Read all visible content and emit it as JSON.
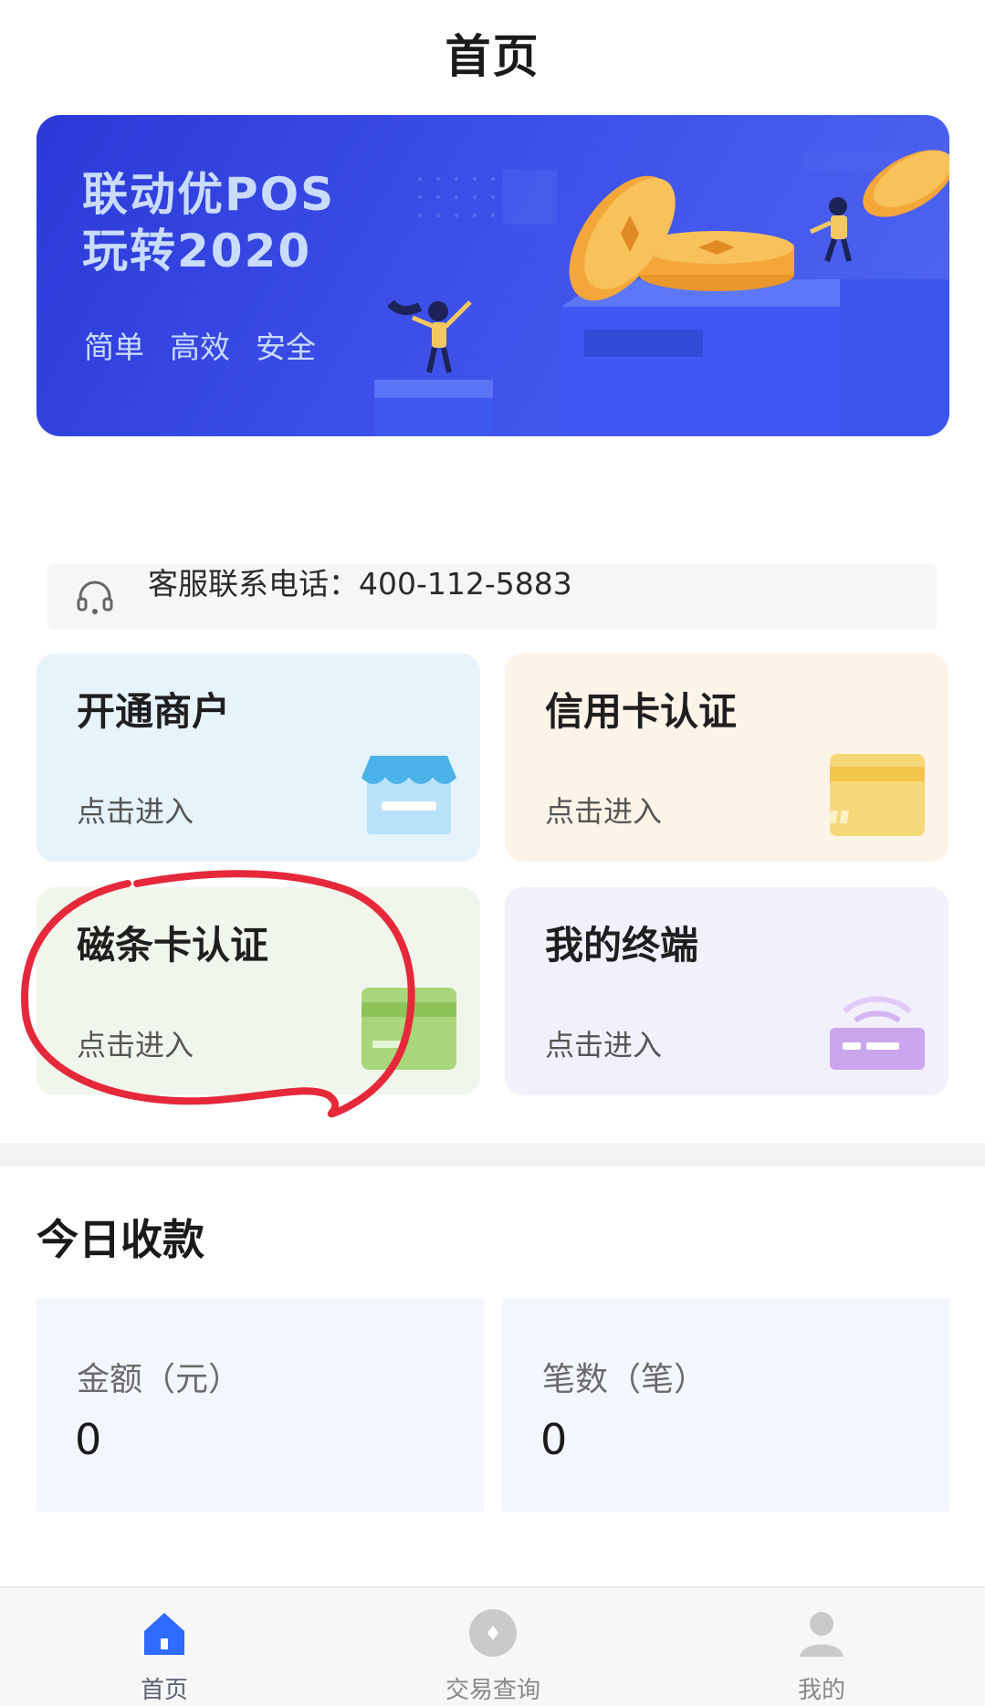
{
  "header": {
    "title": "首页"
  },
  "banner": {
    "title_line1": "联动优POS",
    "title_line2": "玩转2020",
    "tags": [
      "简单",
      "高效",
      "安全"
    ]
  },
  "service": {
    "text": "客服联系电话：400-112-5883",
    "icon": "headset-icon"
  },
  "cards": [
    {
      "title": "开通商户",
      "sub": "点击进入",
      "icon": "store-icon",
      "color": "#e6f3fb"
    },
    {
      "title": "信用卡认证",
      "sub": "点击进入",
      "icon": "credit-card-icon",
      "color": "#fdf4e8"
    },
    {
      "title": "磁条卡认证",
      "sub": "点击进入",
      "icon": "magstripe-card-icon",
      "color": "#f1f6ec"
    },
    {
      "title": "我的终端",
      "sub": "点击进入",
      "icon": "terminal-icon",
      "color": "#f2f0fa"
    }
  ],
  "today": {
    "title": "今日收款",
    "amount_label": "金额（元）",
    "amount_value": "0",
    "count_label": "笔数（笔）",
    "count_value": "0"
  },
  "tabbar": [
    {
      "label": "首页",
      "icon": "home-icon",
      "active": true
    },
    {
      "label": "交易查询",
      "icon": "transaction-query-icon",
      "active": false
    },
    {
      "label": "我的",
      "icon": "profile-icon",
      "active": false
    }
  ],
  "colors": {
    "accent": "#2f6bff",
    "banner": "#3346e0",
    "annotation": "#e5283a"
  }
}
